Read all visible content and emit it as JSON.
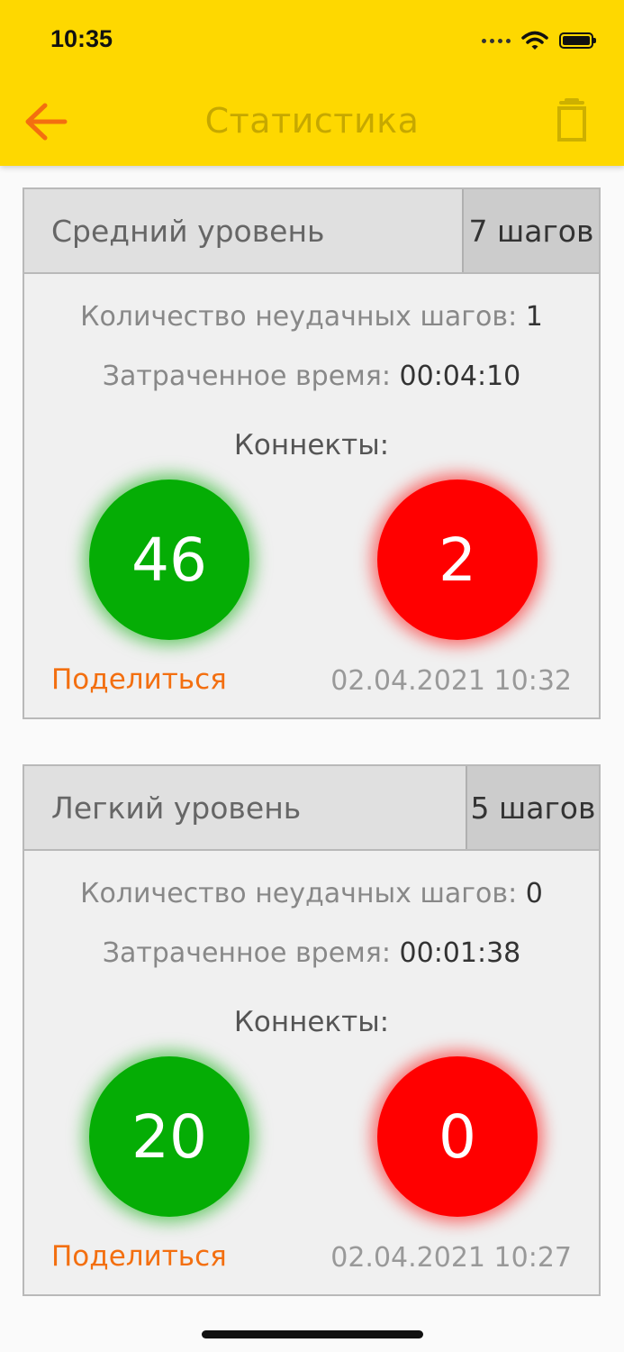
{
  "status_bar": {
    "time": "10:35"
  },
  "app_bar": {
    "title": "Статистика"
  },
  "stats": [
    {
      "level": "Средний уровень",
      "steps": "7 шагов",
      "failed_label": "Количество неудачных шагов:",
      "failed_value": "1",
      "time_label": "Затраченное время:",
      "time_value": "00:04:10",
      "connects_label": "Коннекты:",
      "good": "46",
      "bad": "2",
      "share": "Поделиться",
      "date": "02.04.2021 10:32"
    },
    {
      "level": "Легкий уровень",
      "steps": "5 шагов",
      "failed_label": "Количество неудачных шагов:",
      "failed_value": "0",
      "time_label": "Затраченное время:",
      "time_value": "00:01:38",
      "connects_label": "Коннекты:",
      "good": "20",
      "bad": "0",
      "share": "Поделиться",
      "date": "02.04.2021 10:27"
    }
  ],
  "colors": {
    "app_bar": "#fed800",
    "accent": "#f36f10",
    "success": "#05ad05",
    "error": "#ff0000"
  },
  "icons": {
    "back": "arrow-left-icon",
    "delete": "trash-icon",
    "signal": "cellular-signal-icon",
    "wifi": "wifi-icon",
    "battery": "battery-icon"
  }
}
